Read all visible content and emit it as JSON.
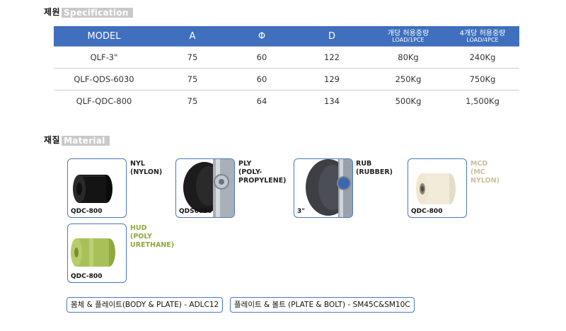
{
  "spec": {
    "title_kr": "제원",
    "title_en": "Specification",
    "headers": [
      {
        "main": "MODEL"
      },
      {
        "main": "A"
      },
      {
        "main": "Φ"
      },
      {
        "main": "D"
      },
      {
        "main": "개당 허용중량",
        "sub": "LOAD/1PCE"
      },
      {
        "main": "4개당 허용중량",
        "sub": "LOAD/4PCE"
      }
    ],
    "rows": [
      [
        "QLF-3\"",
        "75",
        "60",
        "122",
        "80Kg",
        "240Kg"
      ],
      [
        "QLF-QDS-6030",
        "75",
        "60",
        "129",
        "250Kg",
        "750Kg"
      ],
      [
        "QLF-QDC-800",
        "75",
        "64",
        "134",
        "500Kg",
        "1,500Kg"
      ]
    ]
  },
  "material": {
    "title_kr": "재질",
    "title_en": "Material",
    "items": [
      {
        "code": "QDC-800",
        "label": "NYL\n(NYLON)",
        "color": "#111111"
      },
      {
        "code": "QDS6030",
        "label": "PLY\n(POLY-\nPROPYLENE)",
        "color": "#9a9a9a"
      },
      {
        "code": "3\"",
        "label": "RUB\n(RUBBER)",
        "color": "#555555"
      },
      {
        "code": "QDC-800",
        "label": "MCD\n(MC\nNYLON)",
        "color": "#c9bf9a"
      },
      {
        "code": "QDC-800",
        "label": "HUD\n(POLY\nURETHANE)",
        "color": "#8fa83c"
      }
    ]
  },
  "notes": [
    "몸체 & 플레이트(BODY & PLATE) - ADLC12",
    "플레이트 & 볼트 (PLATE & BOLT) - SM45C&SM10C"
  ]
}
